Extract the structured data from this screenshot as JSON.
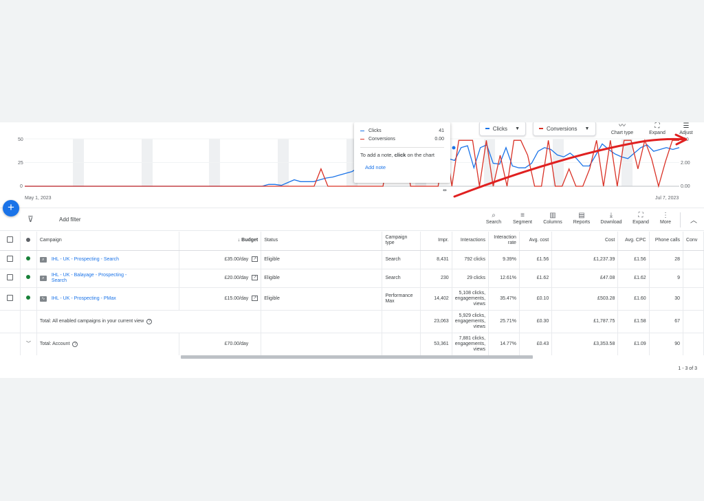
{
  "chart": {
    "start_date": "May 1, 2023",
    "end_date": "Jul 7, 2023",
    "left_axis_ticks": [
      "50",
      "25",
      "0"
    ],
    "right_axis_ticks": [
      ".00",
      "2.00",
      "0.00"
    ],
    "metric1": {
      "label": "Clicks",
      "color": "#1a73e8"
    },
    "metric2": {
      "label": "Conversions",
      "color": "#d93025"
    },
    "tools": {
      "chart_type": "Chart type",
      "expand": "Expand",
      "adjust": "Adjust"
    },
    "tooltip": {
      "rows": [
        {
          "name": "Clicks",
          "value": "41",
          "color": "#1a73e8"
        },
        {
          "name": "Conversions",
          "value": "0.00",
          "color": "#d93025"
        }
      ],
      "note_prefix": "To add a note, ",
      "note_bold": "click",
      "note_suffix": " on the chart",
      "add_note": "Add note"
    },
    "clicks_series": [
      0,
      0,
      0,
      0,
      0,
      0,
      0,
      0,
      0,
      0,
      0,
      0,
      0,
      0,
      0,
      0,
      0,
      0,
      0,
      0,
      0,
      0,
      0,
      0,
      0,
      0,
      0,
      0,
      0,
      0,
      0,
      0,
      0,
      0,
      0,
      0,
      0,
      0,
      2,
      2,
      1,
      4,
      7,
      5,
      5,
      5,
      7,
      9,
      10,
      12,
      14,
      16,
      20,
      28,
      32,
      38,
      42,
      45,
      48,
      50,
      41,
      40,
      38,
      36,
      34,
      32,
      30,
      28,
      42,
      44,
      20,
      42,
      45,
      25,
      24,
      42,
      22,
      20,
      20,
      25,
      38,
      42,
      40,
      34,
      32,
      36,
      30,
      22,
      22,
      34,
      46,
      40,
      35,
      32,
      30,
      36,
      42,
      45,
      38,
      40,
      42,
      40,
      42
    ],
    "conversions_series": [
      0,
      0,
      0,
      0,
      0,
      0,
      0,
      0,
      0,
      0,
      0,
      0,
      0,
      0,
      0,
      0,
      0,
      0,
      0,
      0,
      0,
      0,
      0,
      0,
      0,
      0,
      0,
      0,
      0,
      0,
      0,
      0,
      0,
      0,
      0,
      0,
      0,
      0,
      0,
      0,
      0,
      0,
      0,
      1.4,
      0,
      0,
      0,
      0,
      0,
      0,
      0,
      0,
      0,
      3.3,
      3.3,
      3.3,
      0,
      0,
      0,
      0,
      0,
      3.7,
      0,
      3.7,
      3.7,
      3.7,
      0,
      3.7,
      0,
      2.5,
      0,
      3.7,
      3.7,
      2.5,
      0,
      0,
      3.7,
      0,
      0,
      1.4,
      0,
      0,
      1.4,
      3.7,
      0,
      3.7,
      0,
      3.7,
      3.7,
      1.4,
      3.7,
      2.2,
      0,
      2.0,
      3.7,
      3.7
    ],
    "clicks_max": 62,
    "conv_max": 4.6
  },
  "toolbar": {
    "add_filter": "Add filter",
    "search": "Search",
    "segment": "Segment",
    "columns": "Columns",
    "reports": "Reports",
    "download": "Download",
    "expand": "Expand",
    "more": "More"
  },
  "table": {
    "headers": {
      "campaign": "Campaign",
      "budget": "Budget",
      "status": "Status",
      "campaign_type": "Campaign type",
      "impr": "Impr.",
      "interactions": "Interactions",
      "interaction_rate": "Interaction rate",
      "avg_cost": "Avg. cost",
      "cost": "Cost",
      "avg_cpc": "Avg. CPC",
      "phone_calls": "Phone calls",
      "conv": "Conv"
    },
    "rows": [
      {
        "name": "IHL - UK - Prospecting - Search",
        "icon": "search-campaign-icon",
        "budget": "£35.00/day",
        "status": "Eligible",
        "type": "Search",
        "impr": "8,431",
        "interactions": "792 clicks",
        "rate": "9.39%",
        "avg_cost": "£1.56",
        "cost": "£1,237.39",
        "avg_cpc": "£1.56",
        "phone_calls": "28"
      },
      {
        "name": "IHL - UK - Balayage - Prospecting - Search",
        "icon": "search-campaign-icon",
        "budget": "£20.00/day",
        "status": "Eligible",
        "type": "Search",
        "impr": "230",
        "interactions": "29 clicks",
        "rate": "12.61%",
        "avg_cost": "£1.62",
        "cost": "£47.08",
        "avg_cpc": "£1.62",
        "phone_calls": "9"
      },
      {
        "name": "IHL - UK - Prospecting - PMax",
        "icon": "pmax-campaign-icon",
        "budget": "£15.00/day",
        "status": "Eligible",
        "type": "Performance Max",
        "impr": "14,402",
        "interactions": "5,108 clicks, engagements, views",
        "rate": "35.47%",
        "avg_cost": "£0.10",
        "cost": "£503.28",
        "avg_cpc": "£1.60",
        "phone_calls": "30"
      }
    ],
    "total_enabled": {
      "label": "Total: All enabled campaigns in your current view",
      "impr": "23,063",
      "interactions": "5,929 clicks, engagements, views",
      "rate": "25.71%",
      "avg_cost": "£0.30",
      "cost": "£1,787.75",
      "avg_cpc": "£1.58",
      "phone_calls": "67"
    },
    "total_account": {
      "label": "Total: Account",
      "budget": "£70.00/day",
      "impr": "53,361",
      "interactions": "7,881 clicks, engagements, views",
      "rate": "14.77%",
      "avg_cost": "£0.43",
      "cost": "£3,353.58",
      "avg_cpc": "£1.09",
      "phone_calls": "90"
    }
  },
  "pagination": "1 - 3 of 3",
  "colors": {
    "accent": "#1a73e8",
    "eligible": "#188038",
    "clicks": "#1a73e8",
    "conversions": "#d93025"
  }
}
